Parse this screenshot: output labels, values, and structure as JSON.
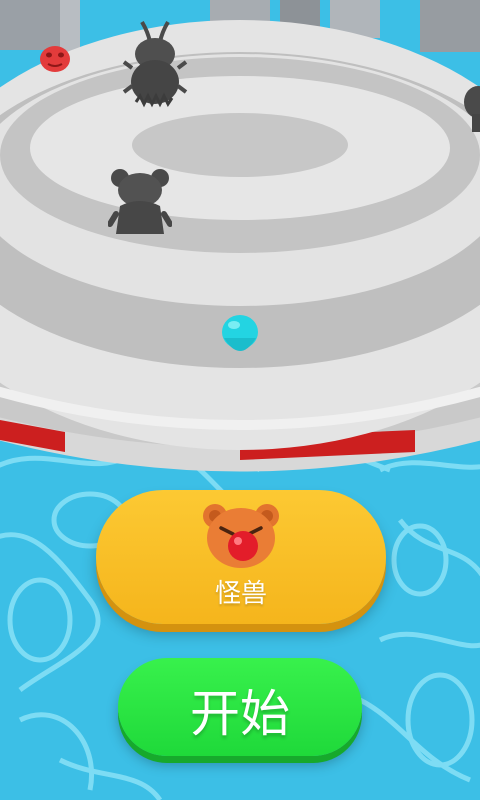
{
  "game": {
    "monster_button": {
      "label": "怪兽",
      "icon": "bear-monster-icon"
    },
    "start_button": {
      "label": "开始"
    }
  },
  "colors": {
    "water": "#3bbfe6",
    "arena": "#d9d9d9",
    "arena_ring": "#c2c2c2",
    "edge_red": "#d01f1f",
    "player": "#1fd3e0",
    "monster": "#4b4b4b",
    "enemy_red": "#e33b3b",
    "monster_button": "#f8bd22",
    "start_button": "#2be440"
  }
}
